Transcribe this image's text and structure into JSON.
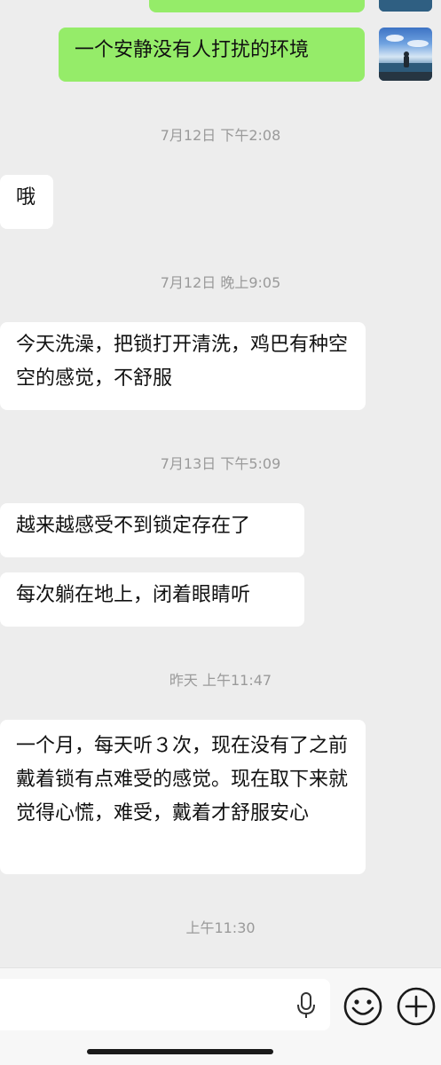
{
  "messages": [
    {
      "side": "out",
      "text": ""
    },
    {
      "side": "out",
      "text": "一个安静没有人打扰的环境"
    },
    {
      "side": "in",
      "text": "哦"
    },
    {
      "side": "in",
      "text": "今天洗澡，把锁打开清洗，鸡巴有种空空的感觉，不舒服"
    },
    {
      "side": "in",
      "text": "越来越感受不到锁定存在了"
    },
    {
      "side": "in",
      "text": "每次躺在地上，闭着眼睛听"
    },
    {
      "side": "in",
      "text": "一个月，每天听３次，现在没有了之前戴着锁有点难受的感觉。现在取下来就觉得心慌，难受，戴着才舒服安心"
    }
  ],
  "timestamps": [
    "7月12日  下午2:08",
    "7月12日  晚上9:05",
    "7月13日  下午5:09",
    "昨天  上午11:47",
    "上午11:30"
  ],
  "colors": {
    "background": "#ededed",
    "incoming": "#ffffff",
    "outgoing": "#95ec69",
    "timestamp": "#9a9a9a"
  },
  "icons": {
    "voice": "microphone-icon",
    "emoji": "emoji-icon",
    "more": "plus-icon"
  }
}
